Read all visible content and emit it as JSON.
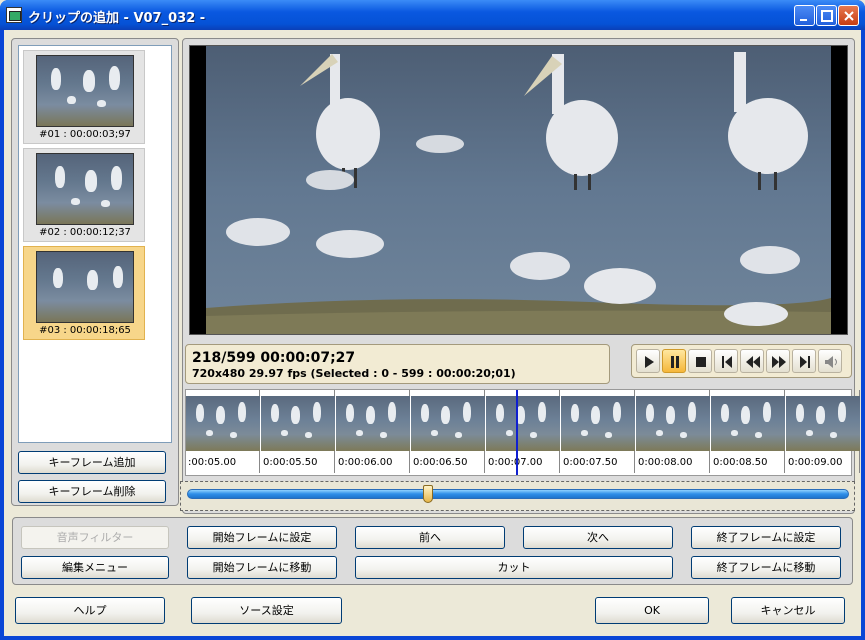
{
  "window": {
    "title": "クリップの追加 - V07_032 -"
  },
  "keyframes": [
    {
      "caption": "#01 : 00:00:03;97",
      "selected": false
    },
    {
      "caption": "#02 : 00:00:12;37",
      "selected": false
    },
    {
      "caption": "#03 : 00:00:18;65",
      "selected": true
    }
  ],
  "keyframe_buttons": {
    "add": "キーフレーム追加",
    "delete": "キーフレーム削除"
  },
  "info": {
    "position": "218/599  00:00:07;27",
    "details": "720x480 29.97 fps  (Selected : 0 - 599 : 00:00:20;01)"
  },
  "transport": {
    "buttons": [
      "play-icon",
      "pause-icon",
      "stop-icon",
      "step-back-icon",
      "rewind-icon",
      "fast-forward-icon",
      "step-forward-icon",
      "speaker-icon"
    ],
    "active": "pause-icon",
    "accent": "#f5b73a"
  },
  "timeline": {
    "labels": [
      ":00:05.00",
      "0:00:05.50",
      "0:00:06.00",
      "0:00:06.50",
      "0:00:07.00",
      "0:00:07.50",
      "0:00:08.00",
      "0:00:08.50",
      "0:00:09.00"
    ],
    "playhead_frame": 218,
    "total_frames": 599,
    "slider_color": "#2e8ee8"
  },
  "actions": {
    "audio_filter": "音声フィルター",
    "set_start": "開始フレームに設定",
    "prev": "前へ",
    "next": "次へ",
    "set_end": "終了フレームに設定",
    "edit_menu": "編集メニュー",
    "goto_start": "開始フレームに移動",
    "cut": "カット",
    "goto_end": "終了フレームに移動"
  },
  "footer": {
    "help": "ヘルプ",
    "source_settings": "ソース設定",
    "ok": "OK",
    "cancel": "キャンセル"
  }
}
